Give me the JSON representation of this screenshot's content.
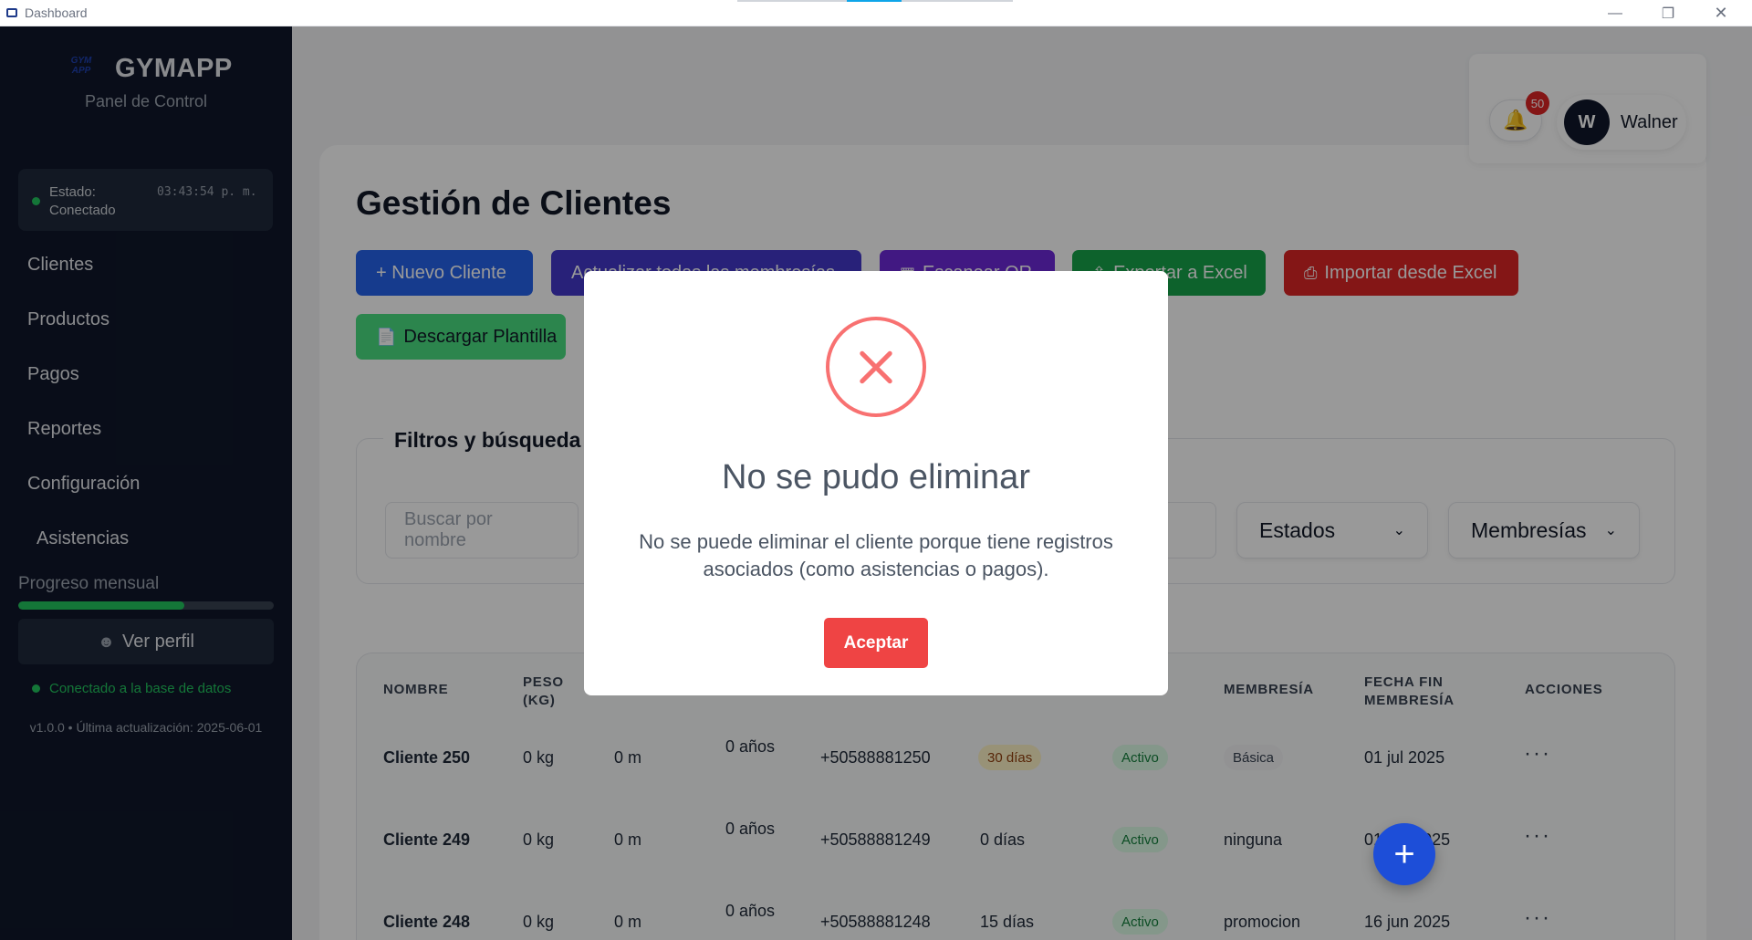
{
  "window": {
    "title": "Dashboard",
    "controls": [
      "minimize",
      "restore",
      "close"
    ]
  },
  "sidebar": {
    "brand": {
      "logo_text": "GYM APP",
      "name": "GYMAPP",
      "subtitle": "Panel de Control"
    },
    "status": {
      "label": "Estado: Conectado",
      "time": "03:43:54 p. m."
    },
    "nav": [
      "Clientes",
      "Productos",
      "Pagos",
      "Reportes",
      "Configuración",
      "Asistencias"
    ],
    "progress": {
      "label": "Progreso mensual",
      "value": 0.65
    },
    "profile_button": "Ver perfil",
    "db_status": "Conectado a la base de datos",
    "version": "v1.0.0 • Última actualización: 2025-06-01"
  },
  "header": {
    "notifications_count": "50",
    "user": {
      "initial": "W",
      "name": "Walner"
    }
  },
  "main": {
    "title": "Gestión de Clientes",
    "buttons": {
      "new_client": "+ Nuevo Cliente",
      "update_all": "Actualizar todas las membresías",
      "qr": "Escanear QR",
      "export": "Exportar a Excel",
      "import": "Importar desde Excel",
      "template": "Descargar Plantilla"
    },
    "filters": {
      "legend": "Filtros y búsqueda",
      "search_placeholder": "Buscar por nombre",
      "estados": "Estados",
      "membresias": "Membresías"
    },
    "table": {
      "headers": [
        "NOMBRE",
        "PESO (KG)",
        "MEMBRESÍA",
        "FECHA FIN MEMBRESÍA",
        "ACCIONES"
      ],
      "rows": [
        {
          "nombre": "Cliente 250",
          "peso": "0 kg",
          "altura": "0 m",
          "edad": "0 años",
          "telefono": "+50588881250",
          "dias": "30 días",
          "estado": "Activo",
          "membresia": "Básica",
          "fecha_fin": "01 jul 2025",
          "acciones": "···"
        },
        {
          "nombre": "Cliente 249",
          "peso": "0 kg",
          "altura": "0 m",
          "edad": "0 años",
          "telefono": "+50588881249",
          "dias": "0 días",
          "estado": "Activo",
          "membresia": "ninguna",
          "fecha_fin": "01 jun 2025",
          "acciones": "···"
        },
        {
          "nombre": "Cliente 248",
          "peso": "0 kg",
          "altura": "0 m",
          "edad": "0 años",
          "telefono": "+50588881248",
          "dias": "15 días",
          "estado": "Activo",
          "membresia": "promocion",
          "fecha_fin": "16 jun 2025",
          "acciones": "···"
        }
      ]
    },
    "fab": "+"
  },
  "modal": {
    "title": "No se pudo eliminar",
    "message": "No se puede eliminar el cliente porque tiene registros asociados (como asistencias o pagos).",
    "button": "Aceptar"
  },
  "colors": {
    "sidebar_bg": "#0f172a",
    "primary": "#2563eb",
    "danger": "#ef4444",
    "success": "#22c55e"
  }
}
